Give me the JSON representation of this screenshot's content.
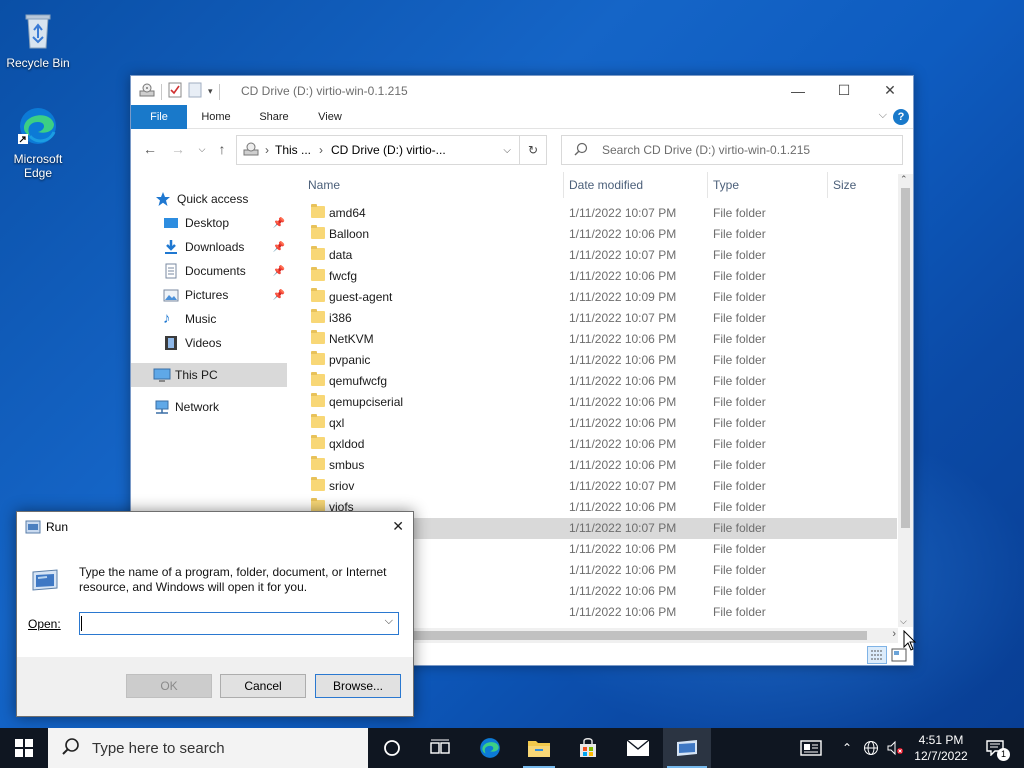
{
  "desktop": {
    "icons": [
      {
        "label": "Recycle Bin"
      },
      {
        "label": "Microsoft Edge"
      }
    ]
  },
  "explorer": {
    "title": "CD Drive (D:) virtio-win-0.1.215",
    "ribbon_tabs": [
      "File",
      "Home",
      "Share",
      "View"
    ],
    "address": {
      "crumb1": "This ...",
      "crumb2": "CD Drive (D:) virtio-..."
    },
    "search_placeholder": "Search CD Drive (D:) virtio-win-0.1.215",
    "nav": {
      "quick_access": "Quick access",
      "items": [
        {
          "label": "Desktop",
          "pinned": true
        },
        {
          "label": "Downloads",
          "pinned": true
        },
        {
          "label": "Documents",
          "pinned": true
        },
        {
          "label": "Pictures",
          "pinned": true
        },
        {
          "label": "Music",
          "pinned": false
        },
        {
          "label": "Videos",
          "pinned": false
        }
      ],
      "this_pc": "This PC",
      "network": "Network"
    },
    "columns": {
      "name": "Name",
      "date": "Date modified",
      "type": "Type",
      "size": "Size"
    },
    "files": [
      {
        "name": "amd64",
        "date": "1/11/2022 10:07 PM",
        "type": "File folder"
      },
      {
        "name": "Balloon",
        "date": "1/11/2022 10:06 PM",
        "type": "File folder"
      },
      {
        "name": "data",
        "date": "1/11/2022 10:07 PM",
        "type": "File folder"
      },
      {
        "name": "fwcfg",
        "date": "1/11/2022 10:06 PM",
        "type": "File folder"
      },
      {
        "name": "guest-agent",
        "date": "1/11/2022 10:09 PM",
        "type": "File folder"
      },
      {
        "name": "i386",
        "date": "1/11/2022 10:07 PM",
        "type": "File folder"
      },
      {
        "name": "NetKVM",
        "date": "1/11/2022 10:06 PM",
        "type": "File folder"
      },
      {
        "name": "pvpanic",
        "date": "1/11/2022 10:06 PM",
        "type": "File folder"
      },
      {
        "name": "qemufwcfg",
        "date": "1/11/2022 10:06 PM",
        "type": "File folder"
      },
      {
        "name": "qemupciserial",
        "date": "1/11/2022 10:06 PM",
        "type": "File folder"
      },
      {
        "name": "qxl",
        "date": "1/11/2022 10:06 PM",
        "type": "File folder"
      },
      {
        "name": "qxldod",
        "date": "1/11/2022 10:06 PM",
        "type": "File folder"
      },
      {
        "name": "smbus",
        "date": "1/11/2022 10:06 PM",
        "type": "File folder"
      },
      {
        "name": "sriov",
        "date": "1/11/2022 10:07 PM",
        "type": "File folder"
      },
      {
        "name": "viofs",
        "date": "1/11/2022 10:06 PM",
        "type": "File folder"
      },
      {
        "name": "",
        "date": "1/11/2022 10:07 PM",
        "type": "File folder",
        "selected": true
      },
      {
        "name": "",
        "date": "1/11/2022 10:06 PM",
        "type": "File folder"
      },
      {
        "name": "",
        "date": "1/11/2022 10:06 PM",
        "type": "File folder"
      },
      {
        "name": "",
        "date": "1/11/2022 10:06 PM",
        "type": "File folder"
      },
      {
        "name": "",
        "date": "1/11/2022 10:06 PM",
        "type": "File folder"
      }
    ]
  },
  "run": {
    "title": "Run",
    "description": "Type the name of a program, folder, document, or Internet resource, and Windows will open it for you.",
    "open_label": "Open:",
    "open_value": "",
    "ok": "OK",
    "cancel": "Cancel",
    "browse": "Browse..."
  },
  "taskbar": {
    "search_placeholder": "Type here to search",
    "time": "4:51 PM",
    "date": "12/7/2022",
    "notification_count": "1"
  },
  "colors": {
    "accent": "#1979ca",
    "selection": "#d9d9d9",
    "taskbar": "#0f1621"
  }
}
